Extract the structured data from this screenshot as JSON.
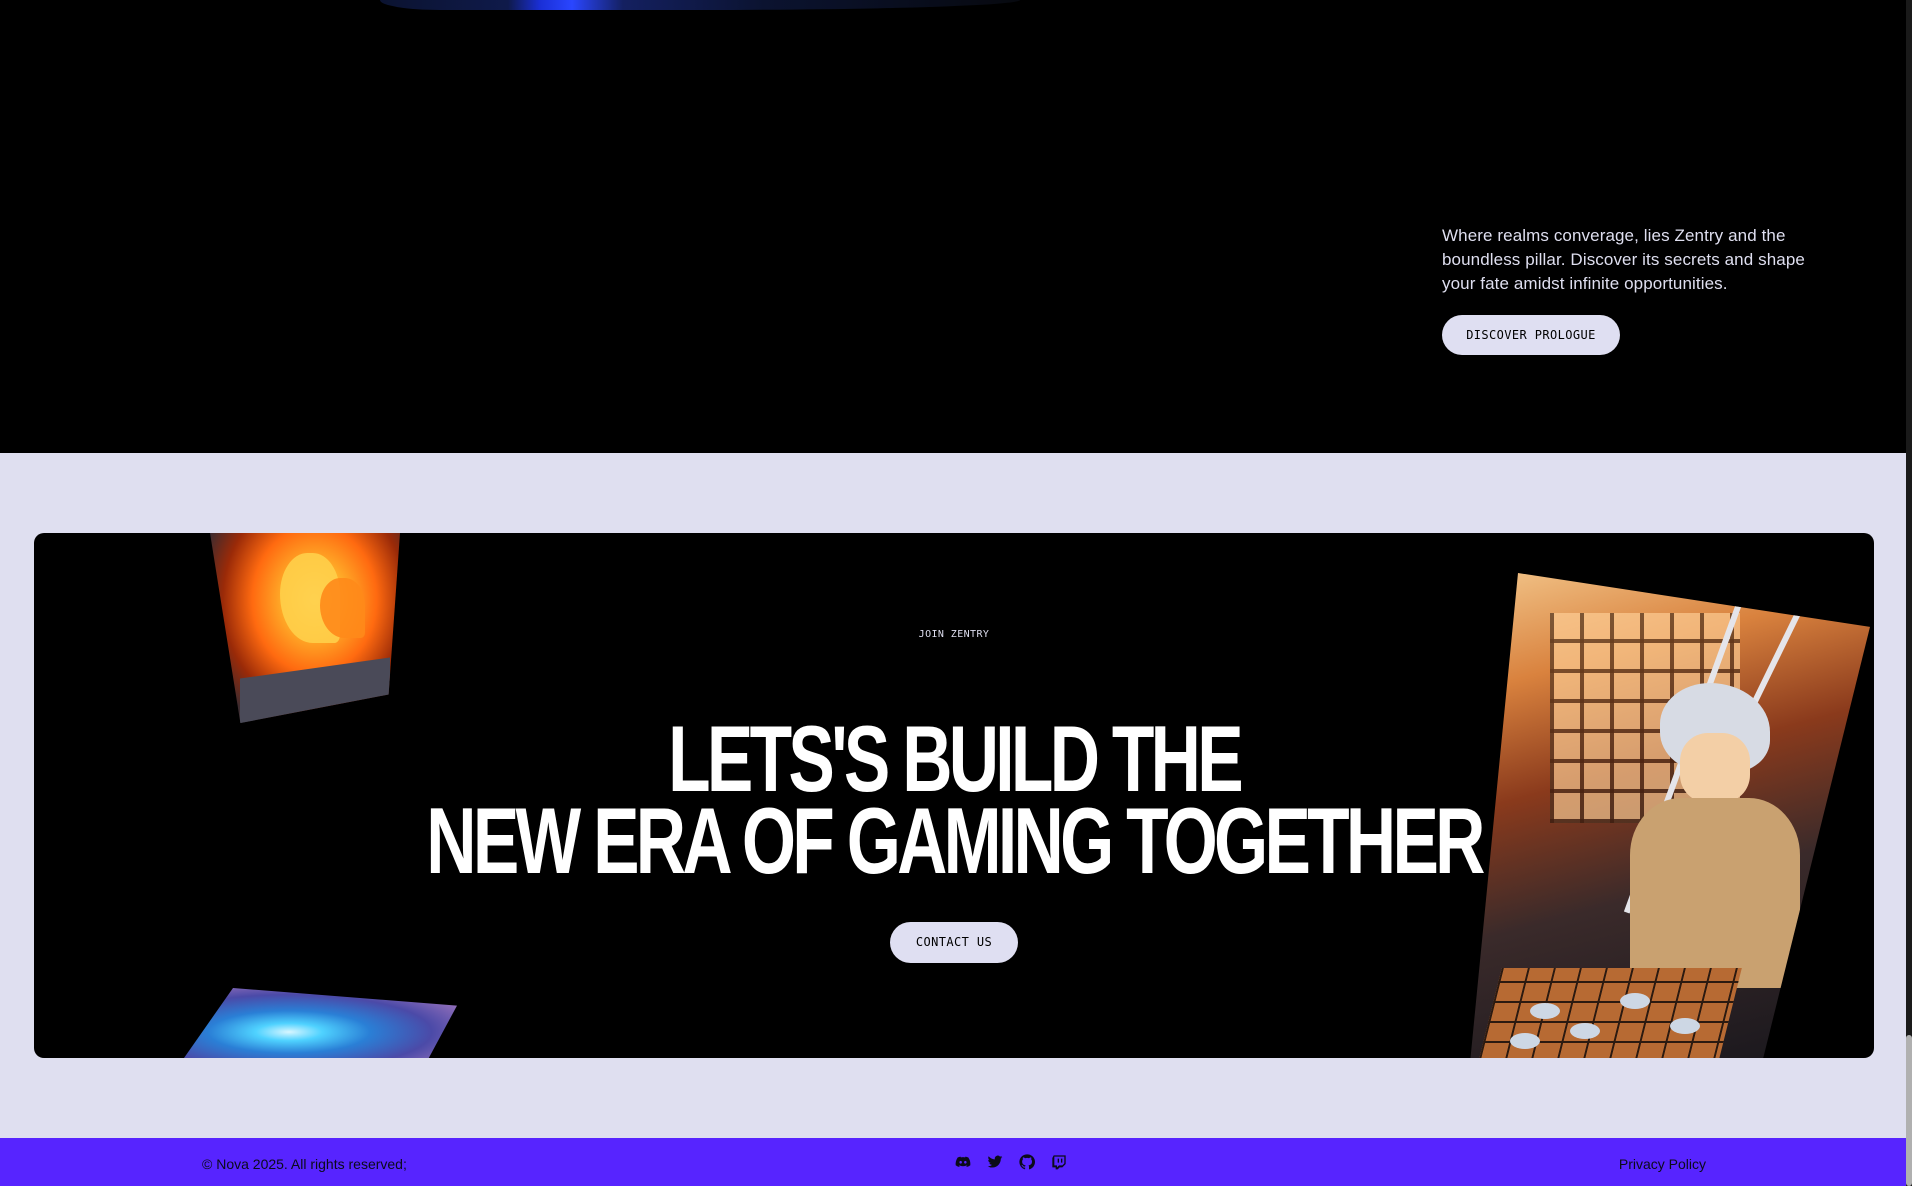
{
  "prologue": {
    "text": "Where realms converage, lies Zentry and the boundless pillar. Discover its secrets and shape your fate amidst infinite opportunities.",
    "button_label": "DISCOVER PROLOGUE"
  },
  "join": {
    "label": "JOIN ZENTRY",
    "headline_line1": "LETS'S BUILD THE",
    "headline_line2": "NEW ERA OF GAMING TOGETHER",
    "button_label": "CONTACT US"
  },
  "footer": {
    "copyright": "© Nova 2025. All rights reserved;",
    "privacy_label": "Privacy Policy",
    "socials": [
      "discord-icon",
      "twitter-icon",
      "github-icon",
      "twitch-icon"
    ]
  },
  "colors": {
    "accent": "#5724ff",
    "light_bg": "#dfdff0",
    "dark_bg": "#000000"
  }
}
